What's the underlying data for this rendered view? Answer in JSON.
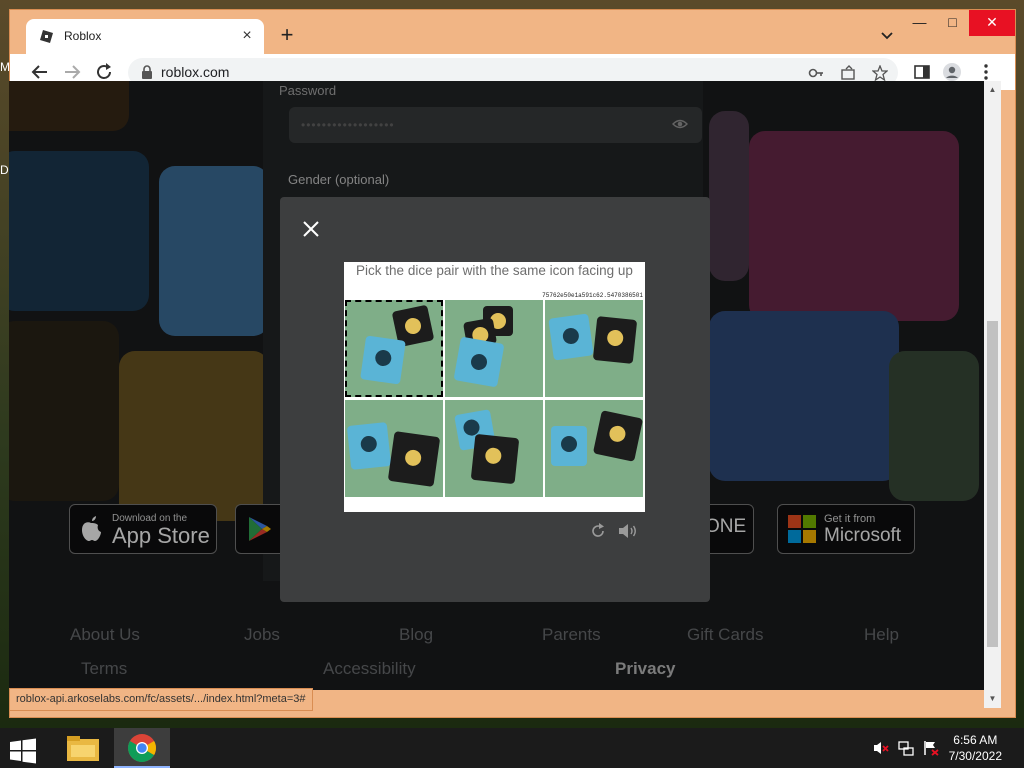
{
  "desktop": {
    "label_m": "M",
    "label_d": "D"
  },
  "browser": {
    "tab_title": "Roblox",
    "url": "roblox.com",
    "status_url": "roblox-api.arkoselabs.com/fc/assets/.../index.html?meta=3#"
  },
  "signup": {
    "password_label": "Password",
    "password_mask": "••••••••••••••••••",
    "gender_label": "Gender (optional)"
  },
  "stores": {
    "app_store_small": "Download on the",
    "app_store_big": "App Store",
    "xbox_partial": "ONE",
    "ms_small": "Get it from",
    "ms_big": "Microsoft"
  },
  "footer": {
    "links_row1": [
      "About Us",
      "Jobs",
      "Blog",
      "Parents",
      "Gift Cards",
      "Help"
    ],
    "links_row2": [
      "Terms",
      "Accessibility",
      "Privacy"
    ]
  },
  "captcha": {
    "prompt": "Pick the dice pair with the same icon facing up",
    "id": "75762e50e1a591c62.5470386501"
  },
  "taskbar": {
    "time": "6:56 AM",
    "date": "7/30/2022"
  },
  "colors": {
    "window_frame": "#f1b585",
    "close_button": "#e81123",
    "dice_blue": "#5ab4d6",
    "dice_black": "#1c1c1c",
    "dice_icon_yellow": "#e2c15a"
  }
}
